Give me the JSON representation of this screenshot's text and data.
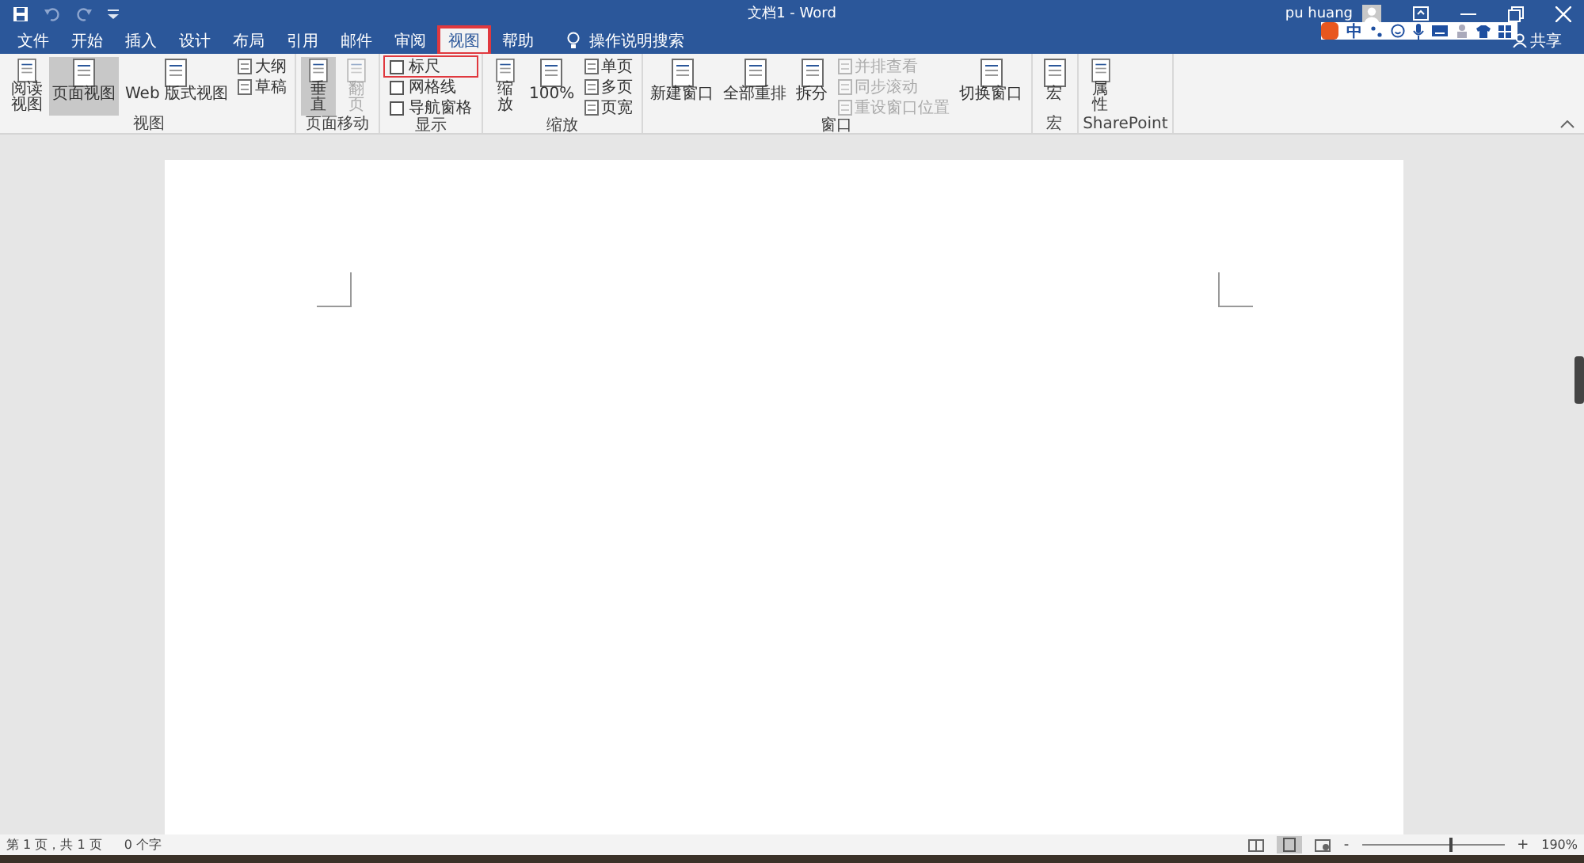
{
  "window": {
    "title": "文档1 - Word",
    "user": "pu huang",
    "share": "共享"
  },
  "ime_bar": {
    "mode": "中"
  },
  "tabs": [
    {
      "label": "文件",
      "selected": false,
      "highlighted": false
    },
    {
      "label": "开始",
      "selected": false,
      "highlighted": false
    },
    {
      "label": "插入",
      "selected": false,
      "highlighted": false
    },
    {
      "label": "设计",
      "selected": false,
      "highlighted": false
    },
    {
      "label": "布局",
      "selected": false,
      "highlighted": false
    },
    {
      "label": "引用",
      "selected": false,
      "highlighted": false
    },
    {
      "label": "邮件",
      "selected": false,
      "highlighted": false
    },
    {
      "label": "审阅",
      "selected": false,
      "highlighted": false
    },
    {
      "label": "视图",
      "selected": true,
      "highlighted": true
    },
    {
      "label": "帮助",
      "selected": false,
      "highlighted": false
    }
  ],
  "search": {
    "placeholder": "操作说明搜索"
  },
  "ribbon_groups": [
    {
      "label": "视图",
      "columns": [
        [
          {
            "kind": "large",
            "label": "阅读视图",
            "stacked": true,
            "selected": false,
            "disabled": false
          }
        ],
        [
          {
            "kind": "large",
            "label": "页面视图",
            "stacked": false,
            "selected": true,
            "disabled": false
          }
        ],
        [
          {
            "kind": "large",
            "label": "Web 版式视图",
            "stacked": false,
            "selected": false,
            "disabled": false
          }
        ],
        [
          {
            "kind": "small",
            "label": "大纲",
            "disabled": false
          },
          {
            "kind": "small",
            "label": "草稿",
            "disabled": false
          }
        ]
      ]
    },
    {
      "label": "页面移动",
      "columns": [
        [
          {
            "kind": "large",
            "label": "垂直",
            "stacked": true,
            "selected": true,
            "disabled": false
          }
        ],
        [
          {
            "kind": "large",
            "label": "翻页",
            "stacked": true,
            "selected": false,
            "disabled": true
          }
        ]
      ]
    },
    {
      "label": "显示",
      "columns": [
        [
          {
            "kind": "check",
            "label": "标尺",
            "checked": false,
            "highlighted": true
          },
          {
            "kind": "check",
            "label": "网格线",
            "checked": false,
            "highlighted": false
          },
          {
            "kind": "check",
            "label": "导航窗格",
            "checked": false,
            "highlighted": false
          }
        ]
      ]
    },
    {
      "label": "缩放",
      "columns": [
        [
          {
            "kind": "large",
            "label": "缩放",
            "stacked": true,
            "selected": false,
            "disabled": false
          }
        ],
        [
          {
            "kind": "large",
            "label": "100%",
            "stacked": false,
            "selected": false,
            "disabled": false
          }
        ],
        [
          {
            "kind": "small",
            "label": "单页",
            "disabled": false
          },
          {
            "kind": "small",
            "label": "多页",
            "disabled": false
          },
          {
            "kind": "small",
            "label": "页宽",
            "disabled": false
          }
        ]
      ]
    },
    {
      "label": "窗口",
      "columns": [
        [
          {
            "kind": "large",
            "label": "新建窗口",
            "stacked": false,
            "selected": false,
            "disabled": false
          }
        ],
        [
          {
            "kind": "large",
            "label": "全部重排",
            "stacked": false,
            "selected": false,
            "disabled": false
          }
        ],
        [
          {
            "kind": "large",
            "label": "拆分",
            "stacked": false,
            "selected": false,
            "disabled": false
          }
        ],
        [
          {
            "kind": "small",
            "label": "并排查看",
            "disabled": true
          },
          {
            "kind": "small",
            "label": "同步滚动",
            "disabled": true
          },
          {
            "kind": "small",
            "label": "重设窗口位置",
            "disabled": true
          }
        ],
        [
          {
            "kind": "large",
            "label": "切换窗口",
            "stacked": false,
            "selected": false,
            "disabled": false
          }
        ]
      ]
    },
    {
      "label": "宏",
      "columns": [
        [
          {
            "kind": "large",
            "label": "宏",
            "selected": false,
            "disabled": false
          }
        ]
      ]
    },
    {
      "label": "SharePoint",
      "columns": [
        [
          {
            "kind": "large",
            "label": "属性",
            "stacked": true,
            "selected": false,
            "disabled": false
          }
        ]
      ]
    }
  ],
  "status_bar": {
    "page": "第 1 页，共 1 页",
    "words": "0 个字",
    "zoom_out": "-",
    "zoom_slider": {
      "level": 0.62
    },
    "zoom_in": "+",
    "zoom": "190%"
  }
}
